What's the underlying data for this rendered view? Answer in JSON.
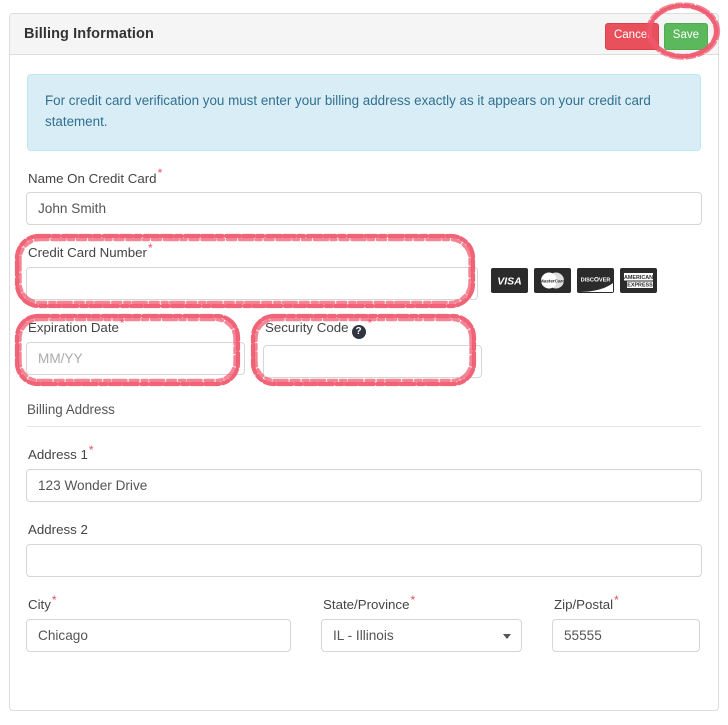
{
  "panel": {
    "title": "Billing Information",
    "cancel_label": "Cancel",
    "save_label": "Save"
  },
  "alert": {
    "text": "For credit card verification you must enter your billing address exactly as it appears on your credit card statement."
  },
  "form": {
    "name_on_card": {
      "label": "Name On Credit Card",
      "required_mark": "*",
      "value": "John Smith"
    },
    "card_number": {
      "label": "Credit Card Number",
      "required_mark": "*",
      "value": "",
      "placeholder": ""
    },
    "expiration": {
      "label": "Expiration Date",
      "required_mark": "*",
      "value": "",
      "placeholder": "MM/YY"
    },
    "security_code": {
      "label": "Security Code",
      "required_mark": "*",
      "help_glyph": "?",
      "value": "",
      "placeholder": ""
    },
    "billing_address_heading": "Billing Address",
    "address1": {
      "label": "Address 1",
      "required_mark": "*",
      "value": "123 Wonder Drive"
    },
    "address2": {
      "label": "Address 2",
      "required_mark": "",
      "value": "",
      "placeholder": ""
    },
    "city": {
      "label": "City",
      "required_mark": "*",
      "value": "Chicago"
    },
    "state": {
      "label": "State/Province",
      "required_mark": "*",
      "value": "IL - Illinois",
      "options": [
        "IL - Illinois"
      ]
    },
    "zip": {
      "label": "Zip/Postal",
      "required_mark": "*",
      "value": "55555"
    }
  },
  "card_brands": [
    {
      "name": "visa",
      "text": "VISA"
    },
    {
      "name": "mastercard",
      "text": "MasterCard"
    },
    {
      "name": "discover",
      "text": "DISCOVER"
    },
    {
      "name": "american-express",
      "text": "AMERICAN EXPRESS"
    }
  ],
  "annotations": [
    {
      "name": "save-button-highlight",
      "shape": "ellipse"
    },
    {
      "name": "credit-card-number-highlight",
      "shape": "rounded-rect"
    },
    {
      "name": "expiration-date-highlight",
      "shape": "rounded-rect"
    },
    {
      "name": "security-code-highlight",
      "shape": "rounded-rect"
    }
  ],
  "colors": {
    "accent_red": "#e8505b",
    "accent_green": "#5cb85c",
    "alert_bg": "#d9edf7",
    "alert_border": "#bce8f1",
    "alert_text": "#31708f",
    "annotation": "#f0566b",
    "panel_border": "#dddddd",
    "heading_bg": "#f5f5f5"
  }
}
